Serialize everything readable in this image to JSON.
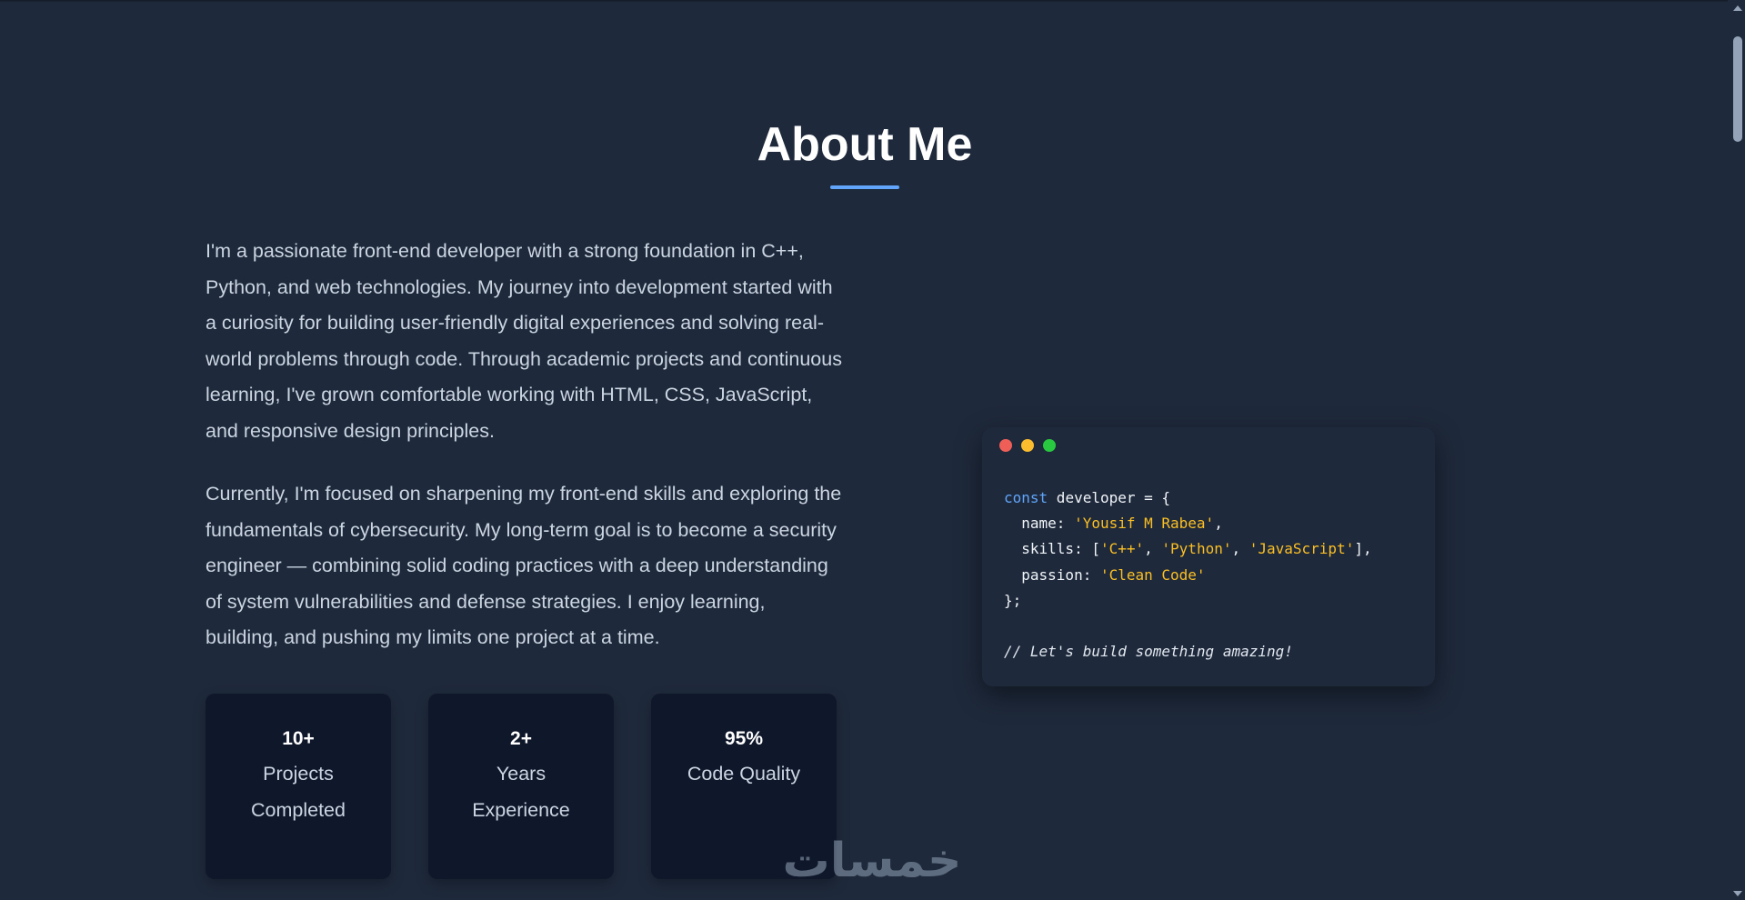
{
  "about": {
    "title": "About Me",
    "paragraphs": [
      "I'm a passionate front-end developer with a strong foundation in C++, Python, and web technologies. My journey into development started with a curiosity for building user-friendly digital experiences and solving real-world problems through code. Through academic projects and continuous learning, I've grown comfortable working with HTML, CSS, JavaScript, and responsive design principles.",
      "Currently, I'm focused on sharpening my front-end skills and exploring the fundamentals of cybersecurity. My long-term goal is to become a security engineer — combining solid coding practices with a deep understanding of system vulnerabilities and defense strategies. I enjoy learning, building, and pushing my limits one project at a time."
    ],
    "stats": [
      {
        "number": "10+",
        "label": "Projects Completed"
      },
      {
        "number": "2+",
        "label": "Years Experience"
      },
      {
        "number": "95%",
        "label": "Code Quality"
      }
    ]
  },
  "code_window": {
    "line1_kw": "const",
    "line1_rest": " developer = {",
    "line2_key": "  name: ",
    "line2_val": "'Yousif M Rabea'",
    "line2_end": ",",
    "line3_key": "  skills: [",
    "line3_v1": "'C++'",
    "line3_v2": "'Python'",
    "line3_v3": "'JavaScript'",
    "line3_end": "],",
    "line4_key": "  passion: ",
    "line4_val": "'Clean Code'",
    "line5": "};",
    "comment": "// Let's build something amazing!"
  },
  "watermark": {
    "text": "خمسات"
  },
  "colors": {
    "background": "#1e293b",
    "card": "#0f172a",
    "accent": "#60a5fa",
    "string": "#fbbf24"
  }
}
